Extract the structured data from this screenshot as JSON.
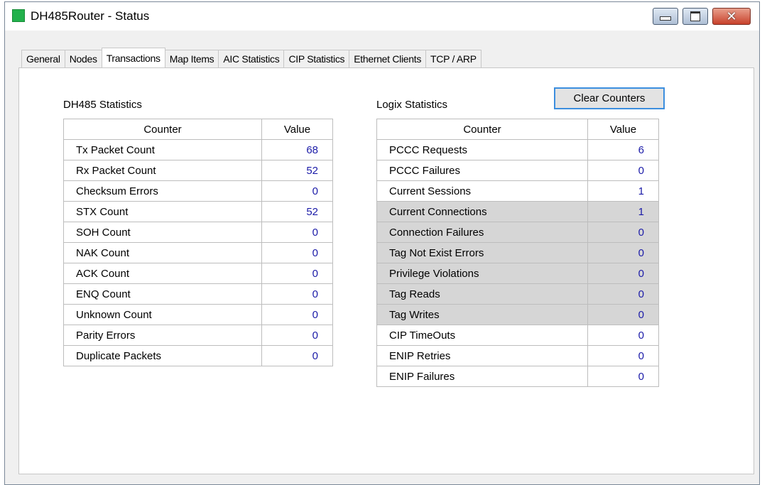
{
  "window": {
    "title": "DH485Router - Status",
    "close_glyph": "✕"
  },
  "tabs": [
    "General",
    "Nodes",
    "Transactions",
    "Map Items",
    "AIC Statistics",
    "CIP Statistics",
    "Ethernet Clients",
    "TCP / ARP"
  ],
  "active_tab": "Transactions",
  "dh485": {
    "title": "DH485 Statistics",
    "headers": {
      "counter": "Counter",
      "value": "Value"
    },
    "rows": [
      {
        "counter": "Tx Packet Count",
        "value": "68"
      },
      {
        "counter": "Rx Packet Count",
        "value": "52"
      },
      {
        "counter": "Checksum Errors",
        "value": "0"
      },
      {
        "counter": "STX Count",
        "value": "52"
      },
      {
        "counter": "SOH Count",
        "value": "0"
      },
      {
        "counter": "NAK Count",
        "value": "0"
      },
      {
        "counter": "ACK Count",
        "value": "0"
      },
      {
        "counter": "ENQ Count",
        "value": "0"
      },
      {
        "counter": "Unknown Count",
        "value": "0"
      },
      {
        "counter": "Parity Errors",
        "value": "0"
      },
      {
        "counter": "Duplicate Packets",
        "value": "0"
      }
    ]
  },
  "logix": {
    "title": "Logix Statistics",
    "clear_button": "Clear Counters",
    "headers": {
      "counter": "Counter",
      "value": "Value"
    },
    "rows": [
      {
        "counter": "PCCC Requests",
        "value": "6",
        "shaded": false
      },
      {
        "counter": "PCCC Failures",
        "value": "0",
        "shaded": false
      },
      {
        "counter": "Current Sessions",
        "value": "1",
        "shaded": false
      },
      {
        "counter": "Current Connections",
        "value": "1",
        "shaded": true
      },
      {
        "counter": "Connection Failures",
        "value": "0",
        "shaded": true
      },
      {
        "counter": "Tag Not Exist Errors",
        "value": "0",
        "shaded": true
      },
      {
        "counter": "Privilege Violations",
        "value": "0",
        "shaded": true
      },
      {
        "counter": "Tag Reads",
        "value": "0",
        "shaded": true
      },
      {
        "counter": "Tag Writes",
        "value": "0",
        "shaded": true
      },
      {
        "counter": "CIP TimeOuts",
        "value": "0",
        "shaded": false
      },
      {
        "counter": "ENIP Retries",
        "value": "0",
        "shaded": false
      },
      {
        "counter": "ENIP Failures",
        "value": "0",
        "shaded": false
      }
    ]
  },
  "colors": {
    "value_text": "#1b1ba8",
    "shaded_row": "#d6d6d6",
    "app_icon": "#22b14c",
    "focus_border": "#3c8ede"
  },
  "icons": [
    "app-icon",
    "minimize-icon",
    "maximize-icon",
    "close-icon"
  ]
}
